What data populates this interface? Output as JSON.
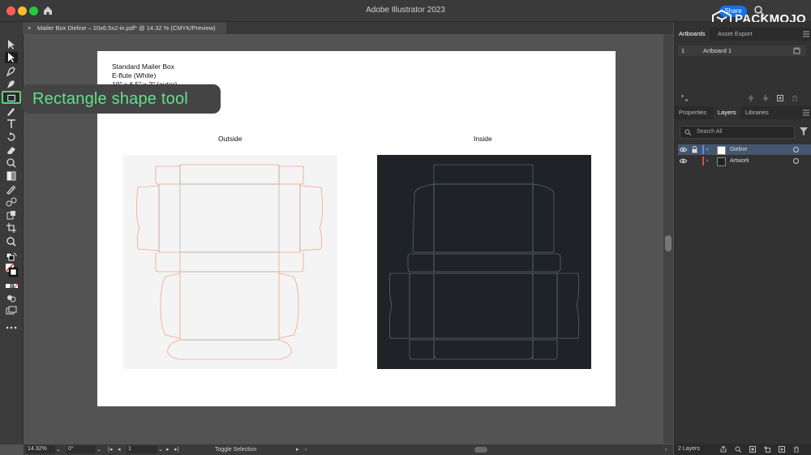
{
  "app": {
    "title": "Adobe Illustrator 2023",
    "share_label": "Share",
    "brand": "PACKMOJO"
  },
  "document": {
    "tab_close": "×",
    "tab_name": "Mailer Box Dieline – 10x6.5x2-in.pdf* @ 14.32 % (CMYK/Preview)"
  },
  "tooltip": {
    "label": "Rectangle shape tool"
  },
  "artboard": {
    "lines": [
      "Standard Mailer Box",
      "E-flute (White)",
      "10\" x 6.5\" x 2\" (outer)"
    ],
    "outside_label": "Outside",
    "inside_label": "Inside"
  },
  "status": {
    "zoom": "14.32%",
    "rotation": "0°",
    "page": "1",
    "action": "Toggle Selection"
  },
  "artboards_panel": {
    "tabs": [
      "Artboards",
      "Asset Export"
    ],
    "rows": [
      {
        "index": "1",
        "name": "Artboard 1"
      }
    ]
  },
  "layers_panel": {
    "tabs": [
      "Properties",
      "Layers",
      "Libraries"
    ],
    "search_placeholder": "Search All",
    "layers": [
      {
        "name": "Dieline",
        "color": "#5a8ef0"
      },
      {
        "name": "Artwork",
        "color": "#e04848"
      }
    ],
    "count_label": "2 Layers"
  },
  "colors": {
    "accent": "#1473e6",
    "tooltip_text": "#5ee28a",
    "dieline_outside": "#f2a58a",
    "dieline_inside": "#5a6470"
  }
}
